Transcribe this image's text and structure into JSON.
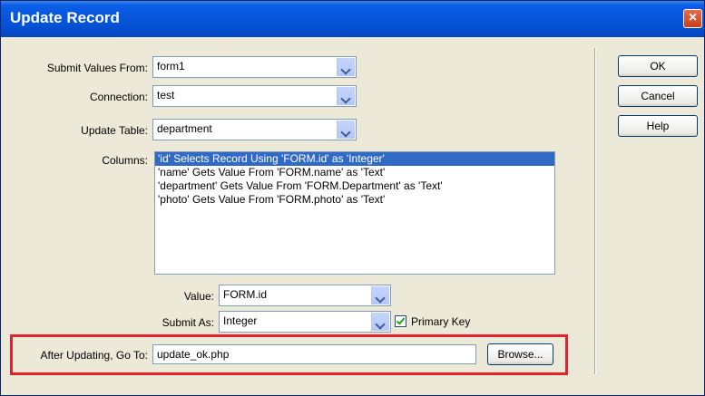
{
  "window": {
    "title": "Update Record",
    "close_glyph": "×"
  },
  "form": {
    "submit_values_from": {
      "label": "Submit Values From:",
      "value": "form1"
    },
    "connection": {
      "label": "Connection:",
      "value": "test"
    },
    "update_table": {
      "label": "Update Table:",
      "value": "department"
    },
    "columns": {
      "label": "Columns:",
      "items": [
        "'id' Selects Record Using 'FORM.id' as 'Integer'",
        "'name' Gets Value From 'FORM.name' as 'Text'",
        "'department' Gets Value From 'FORM.Department' as 'Text'",
        "'photo' Gets Value From 'FORM.photo' as 'Text'"
      ],
      "selected_index": 0
    },
    "value": {
      "label": "Value:",
      "value": "FORM.id"
    },
    "submit_as": {
      "label": "Submit As:",
      "value": "Integer"
    },
    "primary_key": {
      "label": "Primary Key",
      "checked": true
    },
    "after_updating": {
      "label": "After Updating, Go To:",
      "value": "update_ok.php",
      "browse_label": "Browse..."
    }
  },
  "buttons": {
    "ok": "OK",
    "cancel": "Cancel",
    "help": "Help"
  },
  "colors": {
    "highlight": "#e8202a",
    "selection": "#316ac5",
    "titlebar": "#0554d8"
  }
}
